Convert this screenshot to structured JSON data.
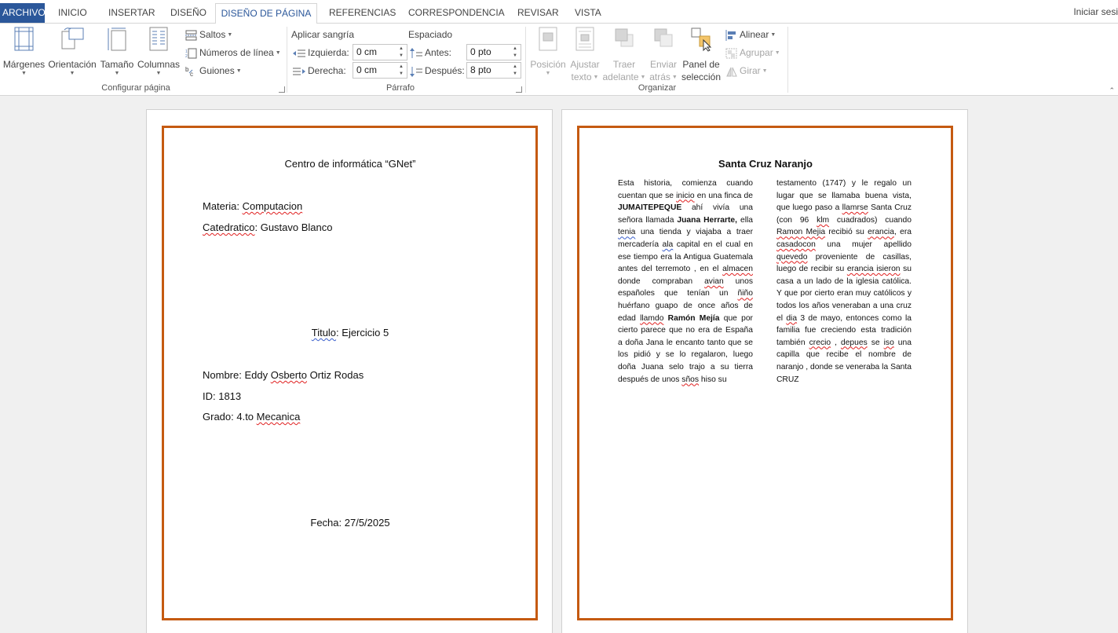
{
  "tabs": {
    "file": "ARCHIVO",
    "items": [
      "INICIO",
      "INSERTAR",
      "DISEÑO",
      "DISEÑO DE PÁGINA",
      "REFERENCIAS",
      "CORRESPONDENCIA",
      "REVISAR",
      "VISTA"
    ],
    "active": "DISEÑO DE PÁGINA",
    "signin": "Iniciar sesi"
  },
  "ribbon": {
    "page_setup": {
      "label": "Configurar página",
      "margins": "Márgenes",
      "orientation": "Orientación",
      "size": "Tamaño",
      "columns": "Columnas",
      "breaks": "Saltos",
      "line_numbers": "Números de línea",
      "hyphenation": "Guiones"
    },
    "paragraph": {
      "label": "Párrafo",
      "indent_title": "Aplicar sangría",
      "spacing_title": "Espaciado",
      "left_label": "Izquierda:",
      "left_value": "0 cm",
      "right_label": "Derecha:",
      "right_value": "0 cm",
      "before_label": "Antes:",
      "before_value": "0 pto",
      "after_label": "Después:",
      "after_value": "8 pto"
    },
    "arrange": {
      "label": "Organizar",
      "position": "Posición",
      "wrap_1": "Ajustar",
      "wrap_2": "texto",
      "forward_1": "Traer",
      "forward_2": "adelante",
      "backward_1": "Enviar",
      "backward_2": "atrás",
      "pane_1": "Panel de",
      "pane_2": "selección",
      "align": "Alinear",
      "group": "Agrupar",
      "rotate": "Girar"
    }
  },
  "page1": {
    "title": "Centro de informática “GNet”",
    "subject_label": "Materia: ",
    "subject_value": "Computacion",
    "teacher_label": "Catedratico",
    "teacher_value": ": Gustavo Blanco",
    "titulo_label": "Titulo",
    "titulo_value": ": Ejercicio 5",
    "name_a": "Nombre: Eddy ",
    "name_b": "Osberto",
    "name_c": " Ortiz Rodas",
    "id": "ID: 1813",
    "grade_a": "Grado: 4.to ",
    "grade_b": "Mecanica",
    "date": "Fecha: 27/5/2025"
  },
  "page2": {
    "title": "Santa Cruz Naranjo"
  },
  "colors": {
    "accent": "#2b579a",
    "page_border": "#c55a11"
  }
}
